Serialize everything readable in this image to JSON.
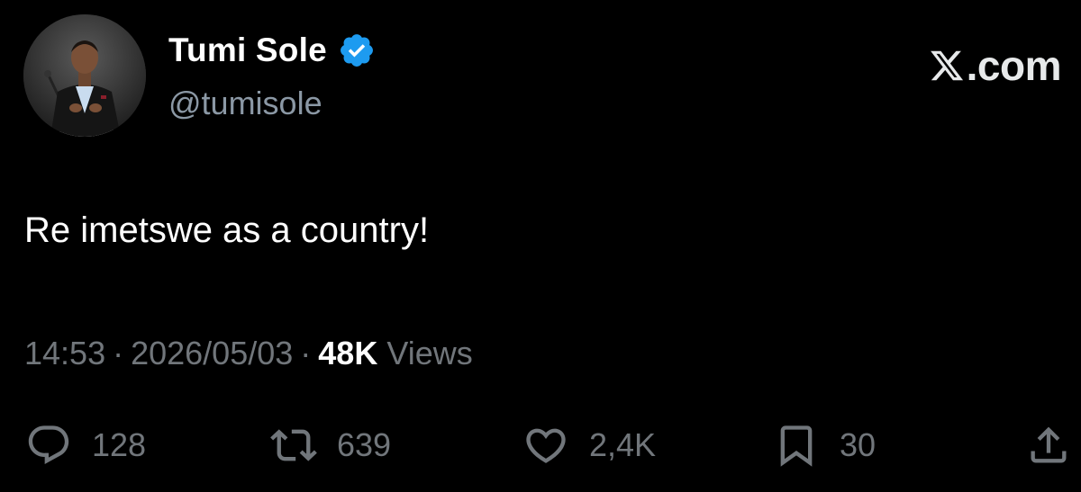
{
  "author": {
    "display_name": "Tumi Sole",
    "handle": "@tumisole",
    "verified": true,
    "avatar_icon": "profile-photo"
  },
  "brand": {
    "text": ".com",
    "icon": "x-logo-icon"
  },
  "tweet": {
    "text": "Re imetswe as a country!"
  },
  "meta": {
    "time": "14:53",
    "separator": "·",
    "date": "2026/05/03",
    "views_count": "48K",
    "views_label": "Views"
  },
  "actions": {
    "replies": "128",
    "reposts": "639",
    "likes": "2,4K",
    "bookmarks": "30"
  },
  "colors": {
    "background": "#000000",
    "primary_text": "#ffffff",
    "secondary_text": "#71767b",
    "verified_badge": "#1d9bf0"
  }
}
